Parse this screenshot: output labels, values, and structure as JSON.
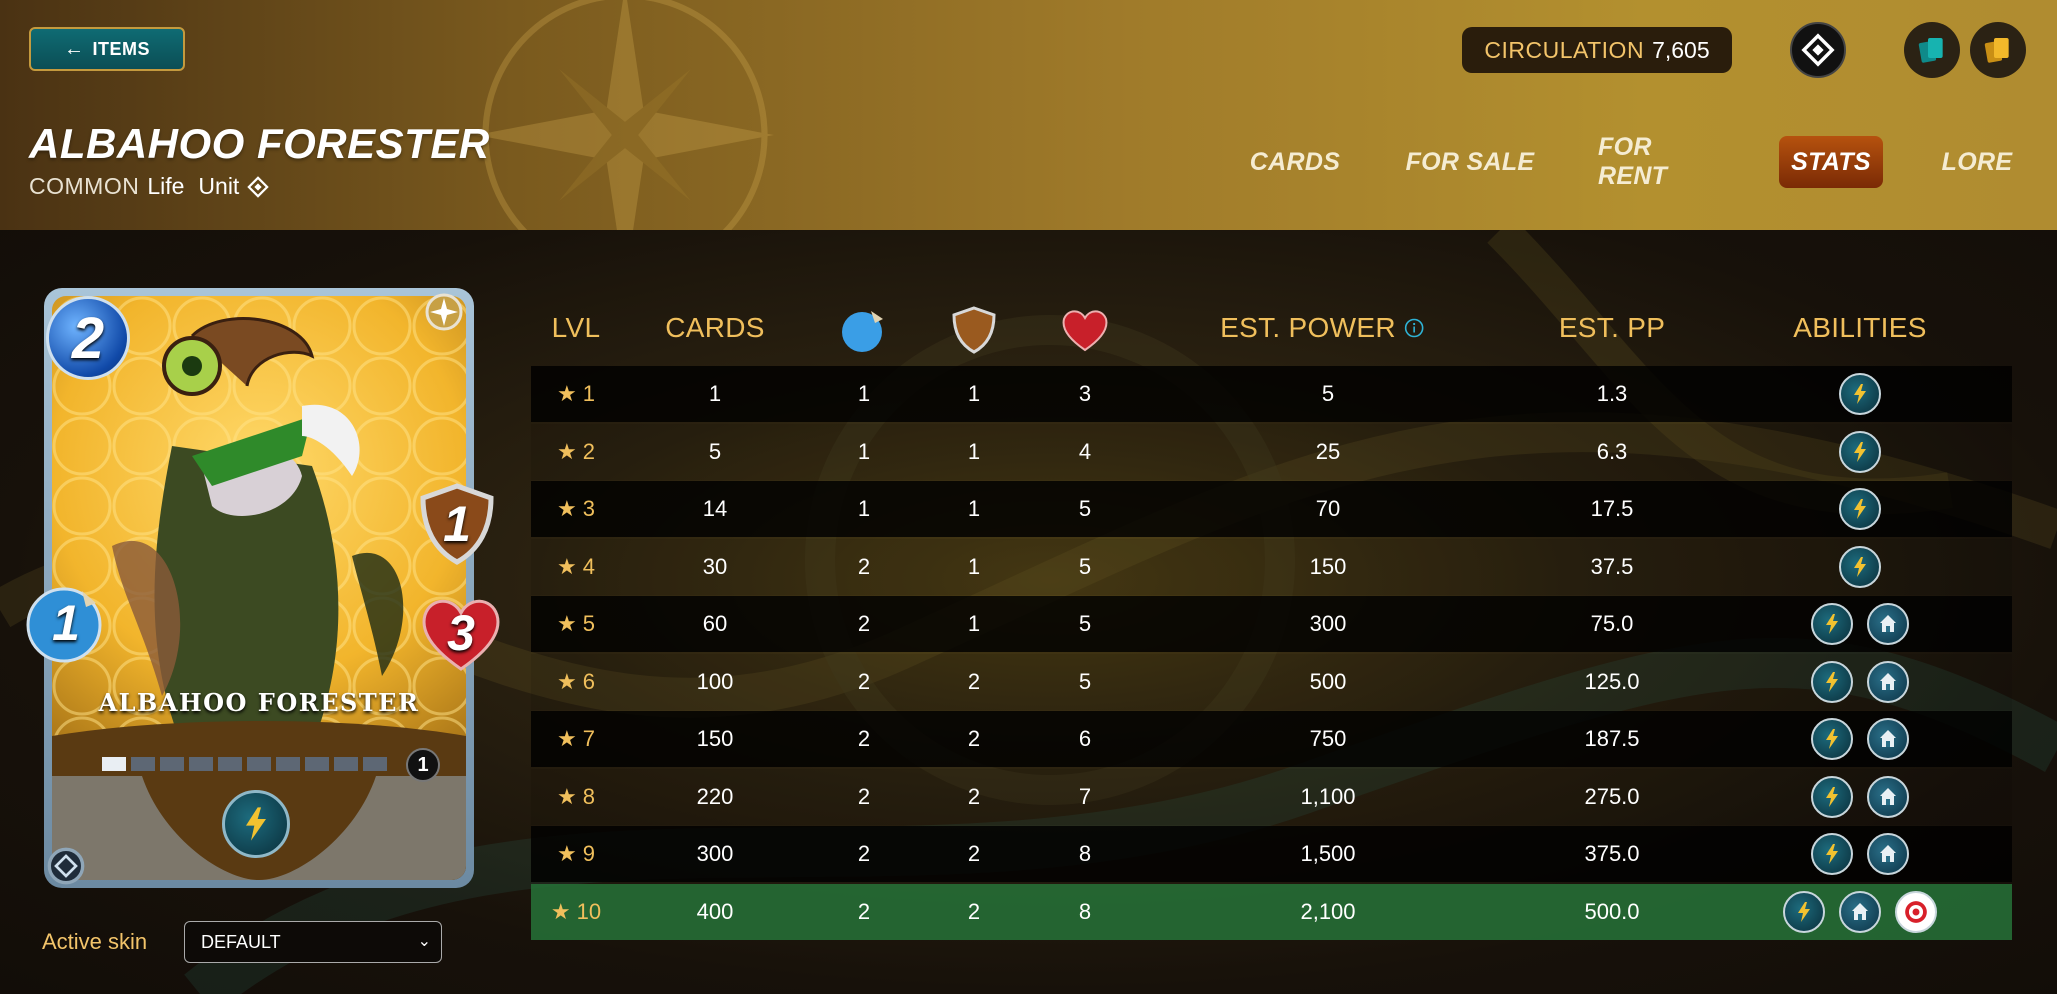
{
  "header": {
    "back_label": "ITEMS",
    "title": "ALBAHOO FORESTER",
    "rarity": "COMMON",
    "element": "Life",
    "type": "Unit",
    "circulation_label": "CIRCULATION",
    "circulation_value": "7,605",
    "tabs": [
      {
        "label": "CARDS",
        "active": false
      },
      {
        "label": "FOR SALE",
        "active": false
      },
      {
        "label": "FOR RENT",
        "active": false
      },
      {
        "label": "STATS",
        "active": true
      },
      {
        "label": "LORE",
        "active": false
      }
    ]
  },
  "card": {
    "name": "ALBAHOO FORESTER",
    "mana": "2",
    "attack": "1",
    "armor": "1",
    "health": "3",
    "level": "1",
    "level_progress_segments": 10,
    "level_progress_filled": 1,
    "ability_icon": "lightning-ability-icon"
  },
  "skin": {
    "label": "Active skin",
    "value": "DEFAULT"
  },
  "table": {
    "headers": {
      "lvl": "LVL",
      "cards": "CARDS",
      "ranged": "ranged-attack-icon",
      "armor": "armor-shield-icon",
      "health": "health-heart-icon",
      "power": "EST. POWER",
      "pp": "EST. PP",
      "abilities": "ABILITIES"
    },
    "rows": [
      {
        "lvl": "1",
        "cards": "1",
        "attack": "1",
        "armor": "1",
        "health": "3",
        "power": "5",
        "pp": "1.3",
        "abilities": [
          "lightning"
        ]
      },
      {
        "lvl": "2",
        "cards": "5",
        "attack": "1",
        "armor": "1",
        "health": "4",
        "power": "25",
        "pp": "6.3",
        "abilities": [
          "lightning"
        ]
      },
      {
        "lvl": "3",
        "cards": "14",
        "attack": "1",
        "armor": "1",
        "health": "5",
        "power": "70",
        "pp": "17.5",
        "abilities": [
          "lightning"
        ]
      },
      {
        "lvl": "4",
        "cards": "30",
        "attack": "2",
        "armor": "1",
        "health": "5",
        "power": "150",
        "pp": "37.5",
        "abilities": [
          "lightning"
        ]
      },
      {
        "lvl": "5",
        "cards": "60",
        "attack": "2",
        "armor": "1",
        "health": "5",
        "power": "300",
        "pp": "75.0",
        "abilities": [
          "lightning",
          "home"
        ]
      },
      {
        "lvl": "6",
        "cards": "100",
        "attack": "2",
        "armor": "2",
        "health": "5",
        "power": "500",
        "pp": "125.0",
        "abilities": [
          "lightning",
          "home"
        ]
      },
      {
        "lvl": "7",
        "cards": "150",
        "attack": "2",
        "armor": "2",
        "health": "6",
        "power": "750",
        "pp": "187.5",
        "abilities": [
          "lightning",
          "home"
        ]
      },
      {
        "lvl": "8",
        "cards": "220",
        "attack": "2",
        "armor": "2",
        "health": "7",
        "power": "1,100",
        "pp": "275.0",
        "abilities": [
          "lightning",
          "home"
        ]
      },
      {
        "lvl": "9",
        "cards": "300",
        "attack": "2",
        "armor": "2",
        "health": "8",
        "power": "1,500",
        "pp": "375.0",
        "abilities": [
          "lightning",
          "home"
        ]
      },
      {
        "lvl": "10",
        "cards": "400",
        "attack": "2",
        "armor": "2",
        "health": "8",
        "power": "2,100",
        "pp": "500.0",
        "abilities": [
          "lightning",
          "home",
          "target"
        ]
      }
    ]
  },
  "colors": {
    "accent_gold": "#f0bf5c",
    "active_tab": "#b6520e",
    "highlight_row": "#257037",
    "back_button": "#0f6b73"
  }
}
